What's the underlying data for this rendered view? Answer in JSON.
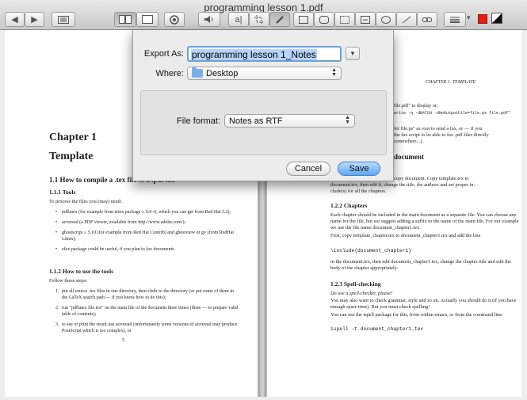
{
  "window": {
    "title": "programming lesson 1.pdf"
  },
  "toolbar": {
    "nav_prev": "◀",
    "nav_next": "▶",
    "sidebar_icon": "sidebar-icon",
    "spread_icon": "two-page-icon",
    "text_tool": "a|",
    "accent": "#e81b0e"
  },
  "dialog": {
    "export_label": "Export As:",
    "export_value": "programming lesson 1_Notes",
    "where_label": "Where:",
    "where_value": "Desktop",
    "format_label": "File format:",
    "format_value": "Notes as RTF",
    "cancel_label": "Cancel",
    "save_label": "Save"
  },
  "left_page": {
    "chapter": "Chapter 1",
    "chapter_title": "Template",
    "s11": "1.1    How to compile a .tex file to a .pdf file",
    "s111": "1.1.1    Tools",
    "tools_intro": "To process the files you (may) need:",
    "tools": [
      "pdflatex (for example from tetex package ≥ 0.9–6, which you can get from Red Hat 5.2);",
      "acroread (a PDF viewer, available from http://www.adobe.com/);",
      "ghostscript ≥ 5.10 (for example from Red Hat Contrib) and ghostview or gv (from RedHat Linux);",
      "efax package could be useful, if you plan to fax documents."
    ],
    "s112": "1.1.2    How to use the tools",
    "steps_intro": "Follow these steps:",
    "steps": [
      {
        "n": "1.",
        "t": "put all source .tex files in one directory, then chdir to the directory (or put some of them in the LaTeX search path — if you know how to do this);"
      },
      {
        "n": "2.",
        "t": "run \"pdflatex file.tex\" on the main file of the document three times (three — to prepare valid table of contents);"
      },
      {
        "n": "3.",
        "t": "to see or print the result use acroread (unfortunately some versions of acroread may produce PostScript which is too complex), or"
      }
    ],
    "page_number": "5"
  },
  "right_page": {
    "running_head": "CHAPTER 1.  TEMPLATE",
    "frag1": "file.pdf\" to display or;",
    "frag2": "write -q -dBATCH -dNoOutputFile=file.ps file.pdf\"",
    "frag3": "fer file.ps\" as root to send a fax, or — if you",
    "frag4": "the fax script to be able to fax .pdf files directly",
    "frag5": "somewhere...).",
    "frag6": "document",
    "frag7": "copy document. Copy template.tex to",
    "frag8": "document.tex, then edit it, change the title, the authors and set proper in-",
    "frag9": "clude(s) for all the chapters.",
    "s122": "1.2.2    Chapters",
    "chapters_p1": "Each chapter should be included in the main document as a separate file. You can choose any name for the file, but we suggest adding a suffix to the name of the main file. For our example we use the file name document_chapter1.tex.",
    "chapters_p2": "First, copy template_chapter.tex to document_chapter1.tex and add the line",
    "include_line": "\\include{document_chapter1}",
    "chapters_p3": "in the document.tex, then edit document_chapter1.tex, change the chapter title and edit the body of the chapter appropriately.",
    "s123": "1.2.3    Spell-checking",
    "spell_p1": "Do use a spell-checker, please!",
    "spell_p2": "You may also want to check grammar, style and so on. Actually you should do it (if you have enough spare time). But you must check spelling!",
    "spell_p3": "You can use the ispell package for this, from within emacs, or from the command line:",
    "ispell_cmd": "ispell -t document_chapter1.tex"
  }
}
